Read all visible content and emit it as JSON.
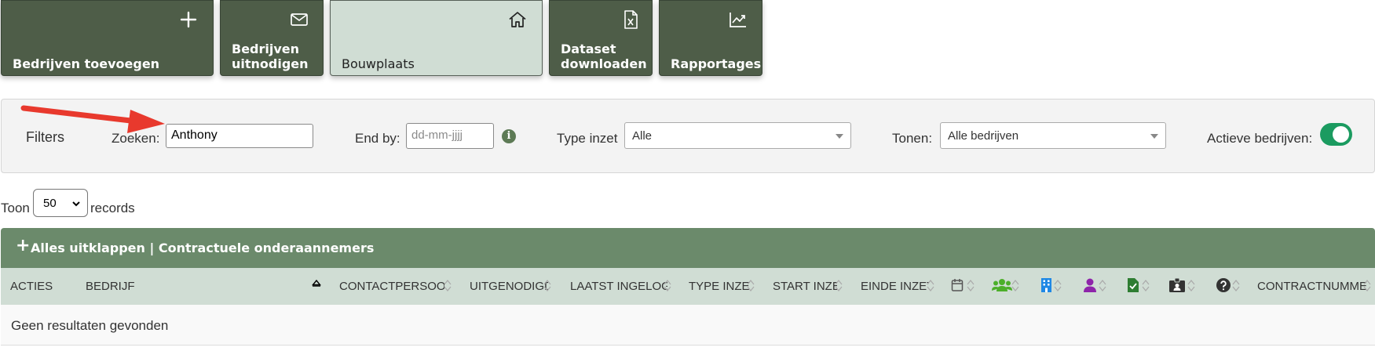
{
  "tiles": [
    {
      "label": "Bedrijven toevoegen",
      "icon": "plus-icon"
    },
    {
      "label": "Bedrijven uitnodigen",
      "icon": "envelope-icon"
    },
    {
      "label": "Bouwplaats",
      "icon": "home-icon"
    },
    {
      "label": "Dataset downloaden",
      "icon": "excel-file-icon"
    },
    {
      "label": "Rapportages",
      "icon": "chart-line-icon"
    }
  ],
  "filters": {
    "title": "Filters",
    "search_label": "Zoeken:",
    "search_value": "Anthony",
    "endby_label": "End by:",
    "endby_placeholder": "dd-mm-jjjj",
    "type_label": "Type inzet",
    "type_value": "Alle",
    "tonen_label": "Tonen:",
    "tonen_value": "Alle bedrijven",
    "active_label": "Actieve bedrijven:",
    "active_on": true
  },
  "records": {
    "prefix": "Toon",
    "page_size": "50",
    "suffix": "records"
  },
  "bar": {
    "expand_label": "Alles uitklappen | Contractuele onderaannemers"
  },
  "columns": [
    "ACTIES",
    "BEDRIJF",
    "CONTACTPERSOON",
    "UITGENODIGD",
    "LAATST INGELOGD",
    "TYPE INZET",
    "START INZET",
    "EINDE INZET",
    "CONTRACTNUMMER"
  ],
  "icon_colors": {
    "calendar": "#555555",
    "users": "#4caf2a",
    "building": "#1e88e5",
    "user": "#8e24aa",
    "document": "#2e7d32",
    "id_card": "#333333",
    "question": "#333333"
  },
  "empty_text": "Geen resultaten gevonden"
}
